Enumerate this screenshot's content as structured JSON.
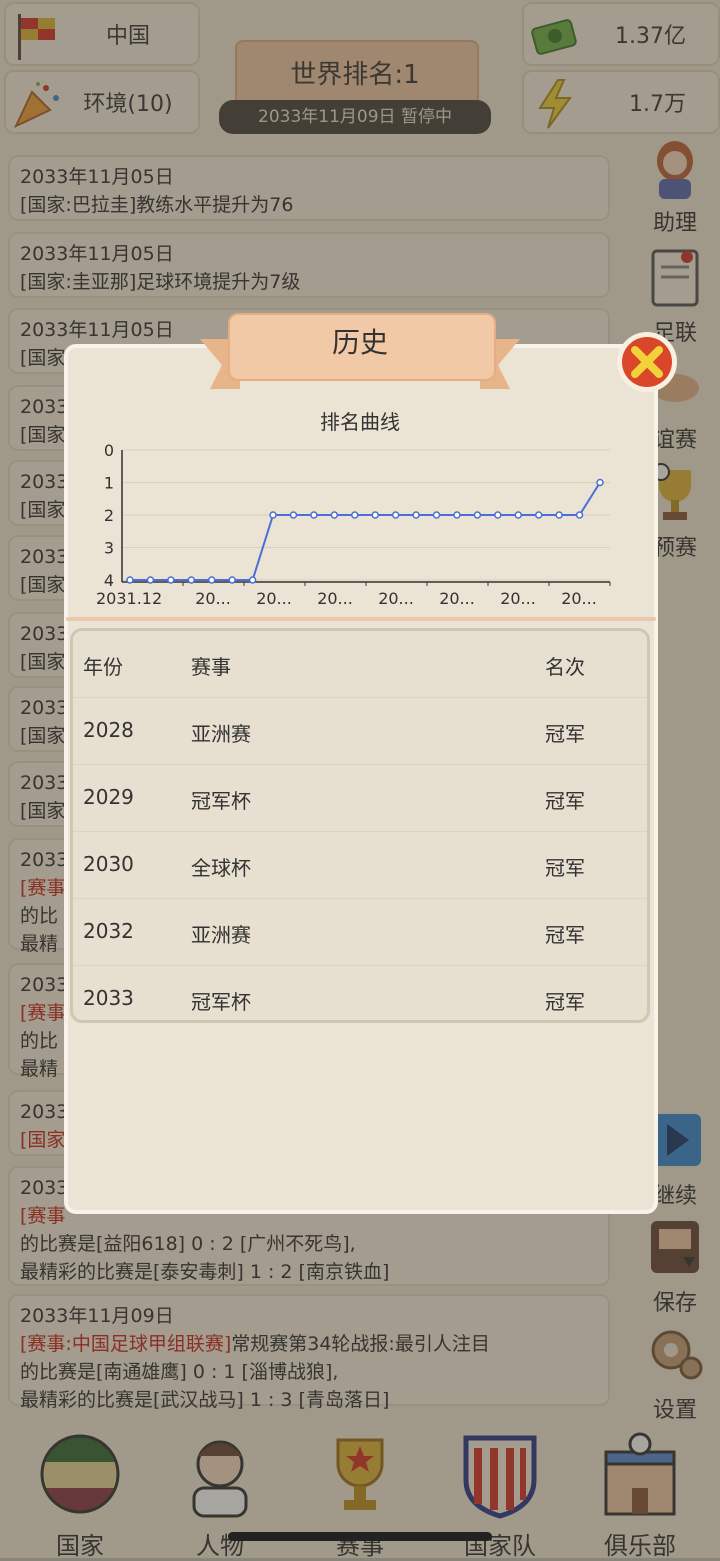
{
  "topbar": {
    "country": "中国",
    "environment": "环境(10)",
    "money": "1.37亿",
    "energy": "1.7万",
    "world_rank": "世界排名:1",
    "date_status": "2033年11月09日  暂停中"
  },
  "feed": [
    {
      "date": "2033年11月05日",
      "text": "[国家:巴拉圭]教练水平提升为76"
    },
    {
      "date": "2033年11月05日",
      "text": "[国家:圭亚那]足球环境提升为7级"
    },
    {
      "date": "2033年11月05日",
      "text": "[国家"
    },
    {
      "date": "2033",
      "text": "[国家"
    },
    {
      "date": "2033",
      "text": "[国家"
    },
    {
      "date": "2033",
      "text": "[国家"
    },
    {
      "date": "2033",
      "text": "[国家"
    },
    {
      "date": "2033",
      "text": "[国家"
    },
    {
      "date": "2033",
      "text": "[国家"
    },
    {
      "date": "2033",
      "red": "[赛事",
      "line2": "的比",
      "line3": "最精"
    },
    {
      "date": "2033",
      "red": "[赛事",
      "line2": "的比",
      "line3": "最精"
    },
    {
      "date": "2033",
      "red": "[国家"
    },
    {
      "date": "2033",
      "red": "[赛事",
      "line2": "的比赛是[益阳618] 0 : 2 [广州不死鸟],",
      "line3": "最精彩的比赛是[泰安毒刺] 1 : 2 [南京铁血]"
    },
    {
      "date": "2033年11月09日",
      "red": "[赛事:中国足球甲组联赛]",
      "text": "常规赛第34轮战报:最引人注目",
      "line2": "的比赛是[南通雄鹰] 0 : 1 [淄博战狼],",
      "line3": "最精彩的比赛是[武汉战马] 1 : 3 [青岛落日]"
    }
  ],
  "rail": {
    "assistant": "助理",
    "league": "足联",
    "friendly": "谊赛",
    "qualifier": "预赛",
    "continue": "继续",
    "save": "保存",
    "settings": "设置"
  },
  "nav": {
    "country": "国家",
    "people": "人物",
    "events": "赛事",
    "national_team": "国家队",
    "club": "俱乐部"
  },
  "modal": {
    "title": "历史",
    "chart_title": "排名曲线",
    "table_headers": [
      "年份",
      "赛事",
      "名次"
    ],
    "rows": [
      [
        "2028",
        "亚洲赛",
        "冠军"
      ],
      [
        "2029",
        "冠军杯",
        "冠军"
      ],
      [
        "2030",
        "全球杯",
        "冠军"
      ],
      [
        "2032",
        "亚洲赛",
        "冠军"
      ],
      [
        "2033",
        "冠军杯",
        "冠军"
      ]
    ]
  },
  "chart_data": {
    "type": "line",
    "title": "排名曲线",
    "y_ticks": [
      "0",
      "1",
      "2",
      "3",
      "4"
    ],
    "ylim": [
      0,
      4
    ],
    "y_inverted": true,
    "x_tick_labels": [
      "2031.12",
      "20...",
      "20...",
      "20...",
      "20...",
      "20...",
      "20...",
      "20..."
    ],
    "series": [
      {
        "values": [
          4,
          4,
          4,
          4,
          4,
          4,
          4,
          2,
          2,
          2,
          2,
          2,
          2,
          2,
          2,
          2,
          2,
          2,
          2,
          2,
          2,
          2,
          2,
          1
        ]
      }
    ],
    "color": "#4a6fd6"
  }
}
